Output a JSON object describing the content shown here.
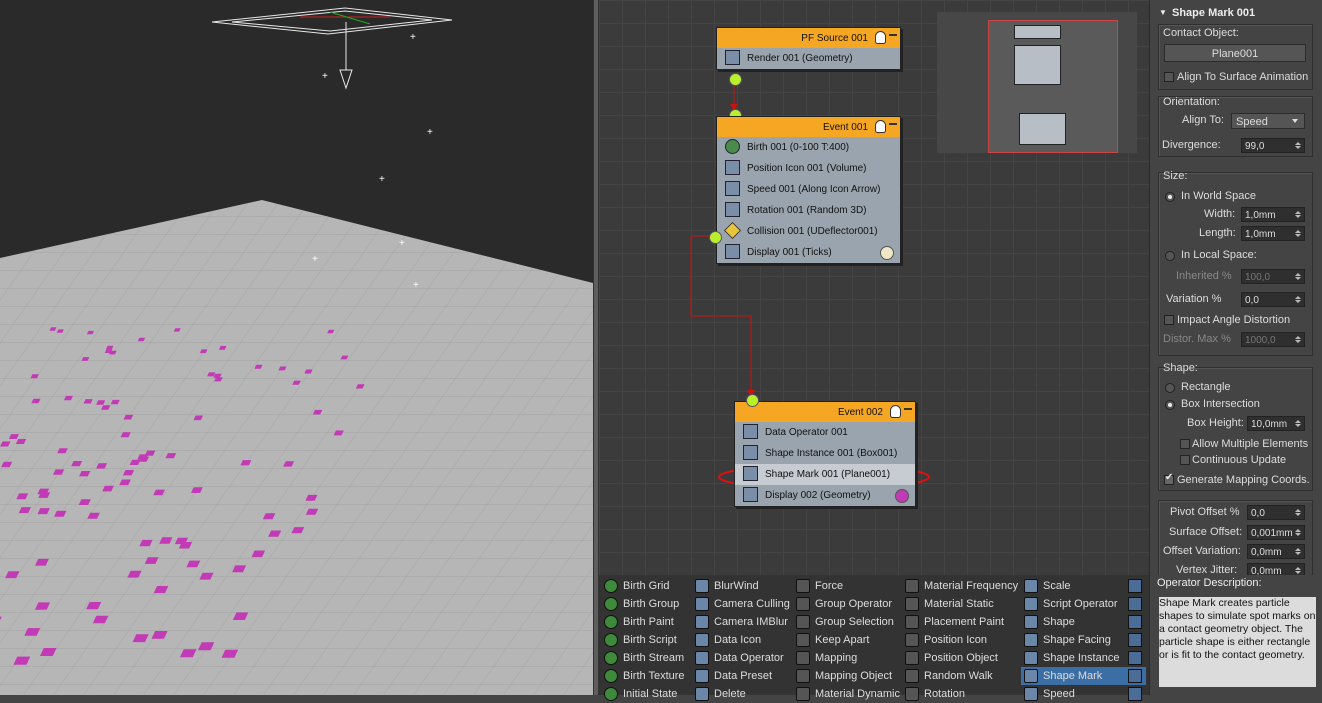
{
  "particle_view": {
    "events": [
      {
        "id": "ev-source",
        "title": "PF Source 001",
        "operators": [
          {
            "label": "Render 001 (Geometry)",
            "icon": "render-icon"
          }
        ]
      },
      {
        "id": "ev-event001",
        "title": "Event 001",
        "operators": [
          {
            "label": "Birth 001 (0-100 T:400)",
            "icon": "birth-icon"
          },
          {
            "label": "Position Icon 001 (Volume)",
            "icon": "position-icon"
          },
          {
            "label": "Speed 001 (Along Icon Arrow)",
            "icon": "speed-icon"
          },
          {
            "label": "Rotation 001 (Random 3D)",
            "icon": "rotation-icon"
          },
          {
            "label": "Collision 001 (UDeflector001)",
            "icon": "collision-icon"
          },
          {
            "label": "Display 001 (Ticks)",
            "icon": "display-icon"
          }
        ]
      },
      {
        "id": "ev-event002",
        "title": "Event 002",
        "operators": [
          {
            "label": "Data Operator 001",
            "icon": "data-operator-icon"
          },
          {
            "label": "Shape Instance 001 (Box001)",
            "icon": "shape-instance-icon"
          },
          {
            "label": "Shape Mark 001 (Plane001)",
            "icon": "shape-mark-icon"
          },
          {
            "label": "Display 002 (Geometry)",
            "icon": "display-icon"
          }
        ]
      }
    ]
  },
  "panel": {
    "title": "Shape Mark 001",
    "contact_object_label": "Contact Object:",
    "contact_object_value": "Plane001",
    "align_to_surface_anim": "Align To Surface Animation",
    "orientation_label": "Orientation:",
    "align_to_label": "Align To:",
    "align_to_value": "Speed",
    "divergence_label": "Divergence:",
    "divergence_value": "99,0",
    "size_label": "Size:",
    "in_world_space": "In World Space",
    "width_label": "Width:",
    "width_value": "1,0mm",
    "length_label": "Length:",
    "length_value": "1,0mm",
    "in_local_space": "In Local Space:",
    "inherited_label": "Inherited %",
    "inherited_value": "100,0",
    "variation_label": "Variation %",
    "variation_value": "0,0",
    "impact_angle": "Impact Angle Distortion",
    "distor_label": "Distor. Max %",
    "distor_value": "1000,0",
    "shape_label": "Shape:",
    "rectangle": "Rectangle",
    "box_intersection": "Box Intersection",
    "box_height_label": "Box Height:",
    "box_height_value": "10,0mm",
    "allow_multiple": "Allow Multiple Elements",
    "continuous_update": "Continuous Update",
    "generate_mapping": "Generate Mapping Coords.",
    "pivot_offset_label": "Pivot Offset %",
    "pivot_offset_value": "0,0",
    "surface_offset_label": "Surface Offset:",
    "surface_offset_value": "0,001mm",
    "offset_variation_label": "Offset Variation:",
    "offset_variation_value": "0,0mm",
    "vertex_jitter_label": "Vertex Jitter:",
    "vertex_jitter_value": "0,0mm"
  },
  "depot": {
    "columns": [
      [
        "Birth Grid",
        "Birth Group",
        "Birth Paint",
        "Birth Script",
        "Birth Stream",
        "Birth Texture",
        "Initial State"
      ],
      [
        "BlurWind",
        "Camera Culling",
        "Camera IMBlur",
        "Data Icon",
        "Data Operator",
        "Data Preset",
        "Delete"
      ],
      [
        "Force",
        "Group Operator",
        "Group Selection",
        "Keep Apart",
        "Mapping",
        "Mapping Object",
        "Material Dynamic"
      ],
      [
        "Material Frequency",
        "Material Static",
        "Placement Paint",
        "Position Icon",
        "Position Object",
        "Random Walk",
        "Rotation"
      ],
      [
        "Scale",
        "Script Operator",
        "Shape",
        "Shape Facing",
        "Shape Instance",
        "Shape Mark",
        "Speed"
      ]
    ],
    "selected": "Shape Mark"
  },
  "description": {
    "title": "Operator Description:",
    "text": "Shape Mark creates particle shapes to simulate spot marks on a contact geometry object. The particle shape is either rectangle or is fit to the contact geometry."
  },
  "colors": {
    "event_header": "#f5a623",
    "socket": "#b9f02a",
    "wire": "#cc1111",
    "highlight_ellipse": "#e01010",
    "particle_marks": "#c23ab5",
    "selection": "#3a6ea5"
  }
}
